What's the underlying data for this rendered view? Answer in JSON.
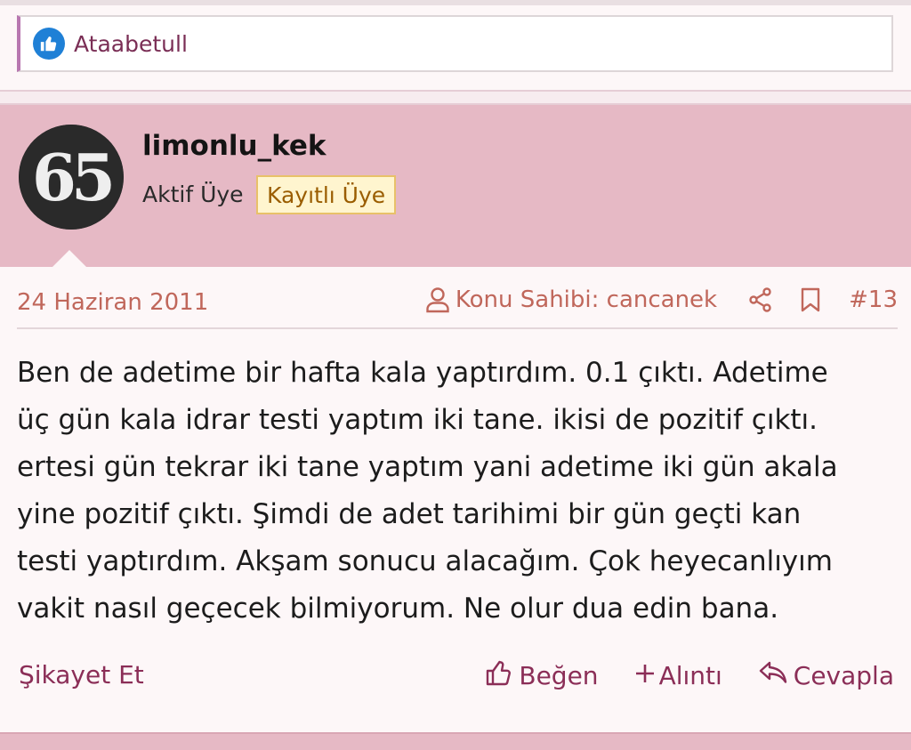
{
  "reactions": {
    "icon": "thumbs-up-icon",
    "names": "Ataabetull"
  },
  "post": {
    "author": {
      "username": "limonlu_kek",
      "avatar_text": "65",
      "title": "Aktif Üye",
      "badge": "Kayıtlı Üye"
    },
    "date": "24 Haziran 2011",
    "thread_owner": "Konu Sahibi: cancanek",
    "post_number": "#13",
    "body_lines": [
      "Ben de adetime bir hafta kala yaptırdım. 0.1 çıktı. Adetime",
      "üç gün kala idrar testi yaptım iki tane. ikisi de pozitif çıktı.",
      "ertesi gün tekrar iki tane yaptım yani adetime iki gün akala",
      "yine pozitif çıktı. Şimdi de adet tarihimi bir gün geçti kan",
      "testi yaptırdım. Akşam sonucu alacağım. Çok heyecanlıyım",
      "vakit nasıl geçecek bilmiyorum. Ne olur dua edin bana."
    ],
    "actions": {
      "report": "Şikayet Et",
      "like": "Beğen",
      "quote": "Alıntı",
      "reply": "Cevapla"
    }
  },
  "colors": {
    "header_bg": "#e6b9c5",
    "accent": "#8b2e57",
    "meta": "#c0675b",
    "badge_bg": "#fff5cf",
    "badge_border": "#e8c169",
    "like_blue": "#1f80d6"
  }
}
